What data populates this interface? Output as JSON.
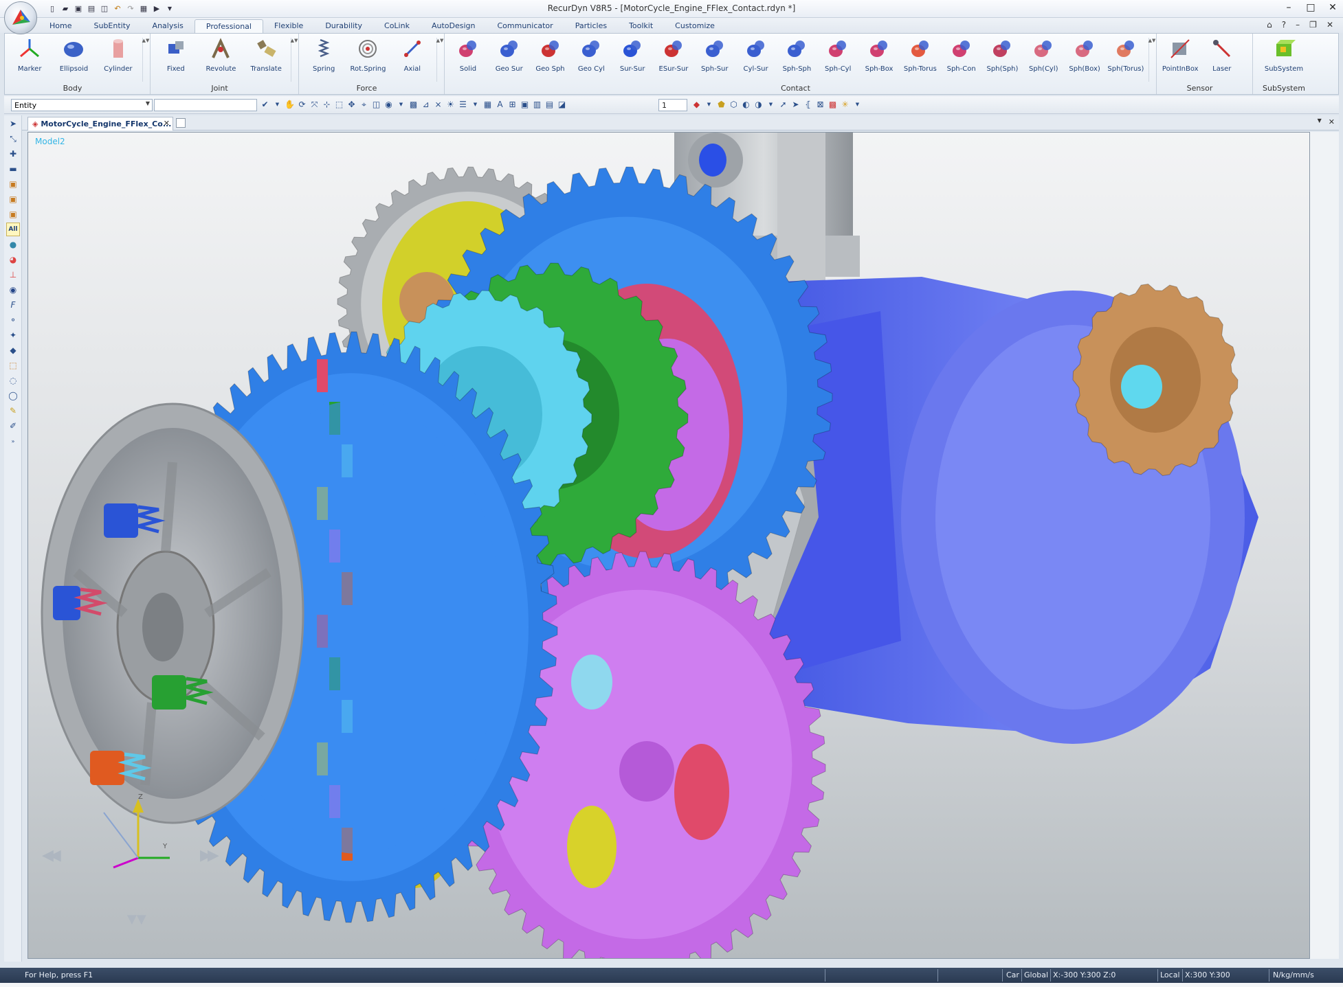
{
  "window": {
    "title": "RecurDyn V8R5 - [MotorCycle_Engine_FFlex_Contact.rdyn *]",
    "controls": [
      "–",
      "□",
      "✕"
    ]
  },
  "tabs": [
    {
      "label": "Home"
    },
    {
      "label": "SubEntity"
    },
    {
      "label": "Analysis"
    },
    {
      "label": "Professional",
      "active": true
    },
    {
      "label": "Flexible"
    },
    {
      "label": "Durability"
    },
    {
      "label": "CoLink"
    },
    {
      "label": "AutoDesign"
    },
    {
      "label": "Communicator"
    },
    {
      "label": "Particles"
    },
    {
      "label": "Toolkit"
    },
    {
      "label": "Customize"
    }
  ],
  "ribbon": {
    "groups": [
      {
        "label": "Body",
        "buttons": [
          {
            "label": "Marker",
            "icon": "marker-icon"
          },
          {
            "label": "Ellipsoid",
            "icon": "ellipsoid-icon"
          },
          {
            "label": "Cylinder",
            "icon": "cylinder-icon"
          }
        ]
      },
      {
        "label": "Joint",
        "buttons": [
          {
            "label": "Fixed",
            "icon": "fixed-joint-icon"
          },
          {
            "label": "Revolute",
            "icon": "revolute-joint-icon"
          },
          {
            "label": "Translate",
            "icon": "translate-joint-icon"
          }
        ]
      },
      {
        "label": "Force",
        "buttons": [
          {
            "label": "Spring",
            "icon": "spring-icon"
          },
          {
            "label": "Rot.Spring",
            "icon": "rot-spring-icon"
          },
          {
            "label": "Axial",
            "icon": "axial-force-icon"
          }
        ]
      },
      {
        "label": "Contact",
        "buttons": [
          {
            "label": "Solid",
            "icon": "solid-contact-icon"
          },
          {
            "label": "Geo Sur",
            "icon": "geo-sur-icon"
          },
          {
            "label": "Geo Sph",
            "icon": "geo-sph-icon"
          },
          {
            "label": "Geo Cyl",
            "icon": "geo-cyl-icon"
          },
          {
            "label": "Sur-Sur",
            "icon": "sur-sur-icon"
          },
          {
            "label": "ESur-Sur",
            "icon": "esur-sur-icon"
          },
          {
            "label": "Sph-Sur",
            "icon": "sph-sur-icon"
          },
          {
            "label": "Cyl-Sur",
            "icon": "cyl-sur-icon"
          },
          {
            "label": "Sph-Sph",
            "icon": "sph-sph-icon"
          },
          {
            "label": "Sph-Cyl",
            "icon": "sph-cyl-icon"
          },
          {
            "label": "Sph-Box",
            "icon": "sph-box-icon"
          },
          {
            "label": "Sph-Torus",
            "icon": "sph-torus-icon"
          },
          {
            "label": "Sph-Con",
            "icon": "sph-con-icon"
          },
          {
            "label": "Sph(Sph)",
            "icon": "sph-in-sph-icon"
          },
          {
            "label": "Sph(Cyl)",
            "icon": "sph-in-cyl-icon"
          },
          {
            "label": "Sph(Box)",
            "icon": "sph-in-box-icon"
          },
          {
            "label": "Sph(Torus)",
            "icon": "sph-in-torus-icon"
          }
        ]
      },
      {
        "label": "Sensor",
        "buttons": [
          {
            "label": "PointInBox",
            "icon": "point-in-box-icon"
          },
          {
            "label": "Laser",
            "icon": "laser-icon"
          }
        ]
      },
      {
        "label": "SubSystem",
        "buttons": [
          {
            "label": "SubSystem",
            "icon": "subsystem-icon"
          }
        ]
      }
    ]
  },
  "toolbar": {
    "entity_combo": "Entity",
    "number_combo": "1"
  },
  "document": {
    "tab_label": "MotorCycle_Engine_FFlex_Co...",
    "model_label": "Model2"
  },
  "viewport": {
    "axis_z": "Z",
    "axis_y": "Y",
    "nav_prev": "◀◀",
    "nav_next": "▶▶",
    "nav_down": "▼▼"
  },
  "status": {
    "help": "For Help, press F1",
    "coord_system": "Car",
    "frame": "Global",
    "global_coords": "X:-300 Y:300 Z:0",
    "local_label": "Local",
    "local_coords": "X:300 Y:300",
    "units": "N/kg/mm/s"
  },
  "colors": {
    "gear_blue": "#2f7fe6",
    "gear_purple": "#c46ae6",
    "gear_gray": "#a9adb1",
    "gear_cyan": "#5fd3ee",
    "gear_green": "#2faa3a",
    "gear_bronze": "#c8915a",
    "crank_blue": "#5a6ef0",
    "crank_gray": "#c3c7cb",
    "yellow_part": "#d8d22a",
    "status_bar": "#2f405a"
  }
}
